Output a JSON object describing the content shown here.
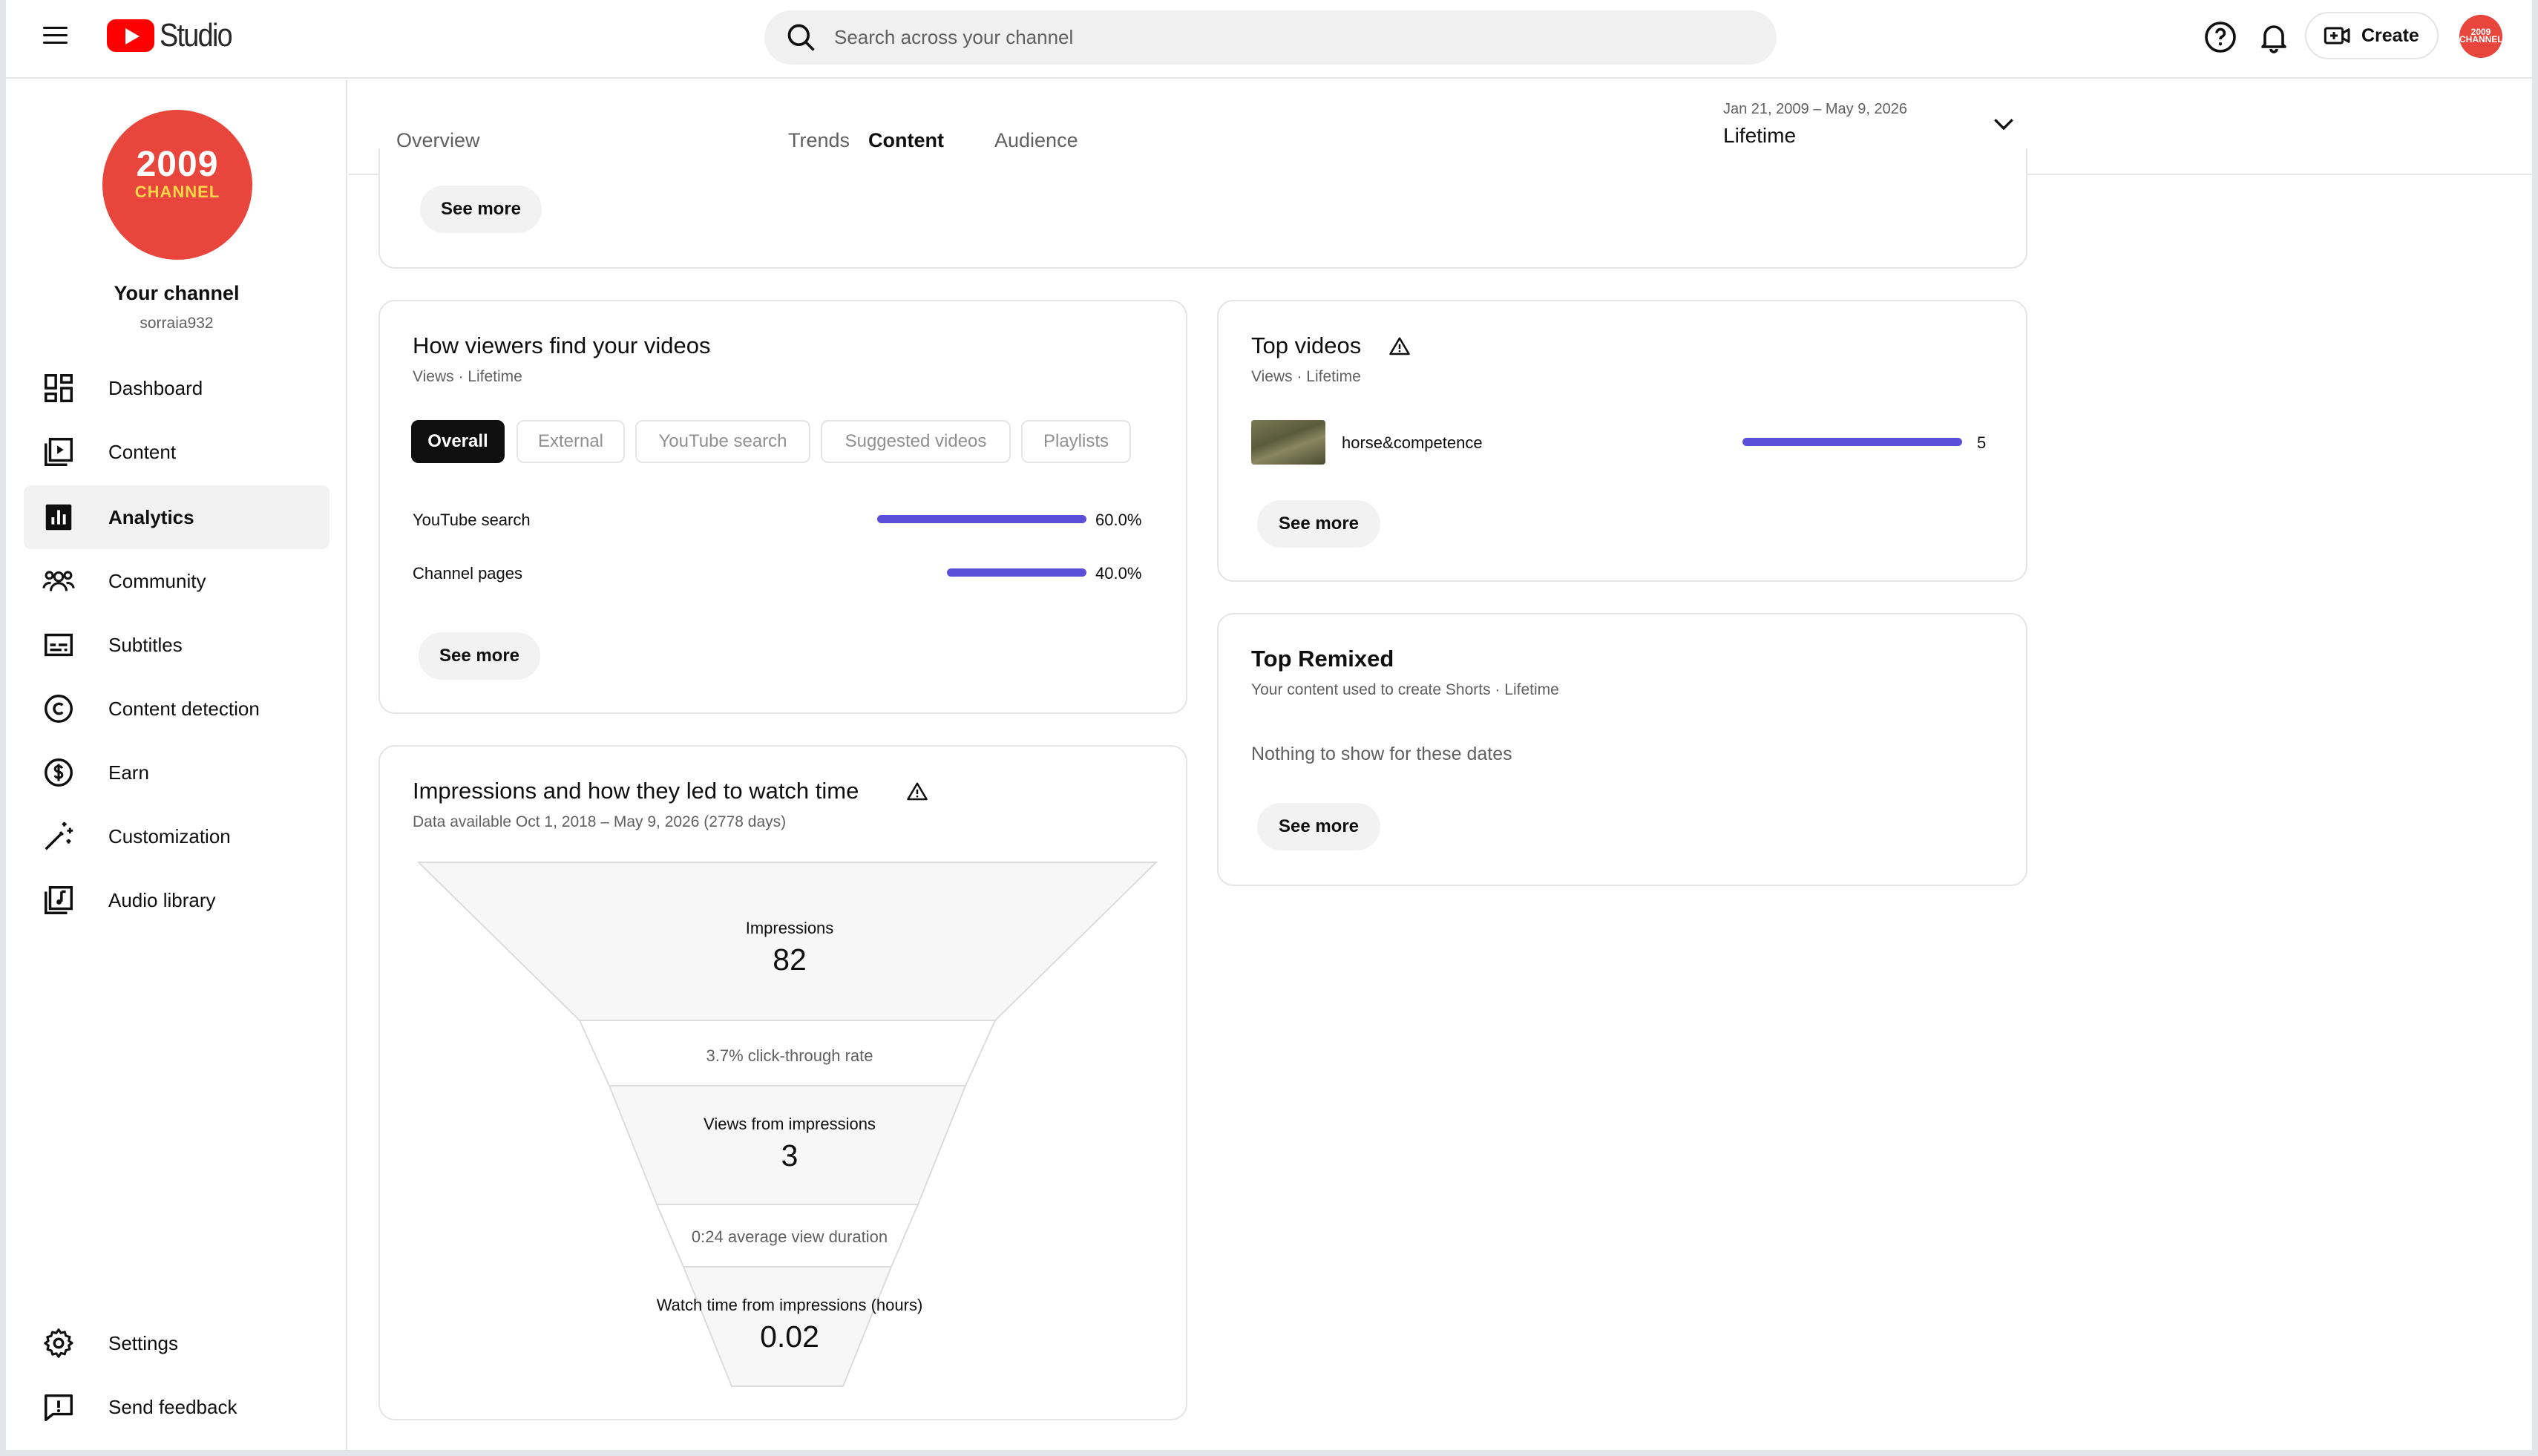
{
  "header": {
    "logo_text": "Studio",
    "search_placeholder": "Search across your channel",
    "create_label": "Create",
    "avatar_text": "2009 CHANNEL"
  },
  "sidebar": {
    "avatar_line1": "2009",
    "avatar_line2": "CHANNEL",
    "channel_name": "Your channel",
    "channel_handle": "sorraia932",
    "items": [
      {
        "label": "Dashboard",
        "icon": "dashboard-icon"
      },
      {
        "label": "Content",
        "icon": "content-icon"
      },
      {
        "label": "Analytics",
        "icon": "analytics-icon",
        "active": true
      },
      {
        "label": "Community",
        "icon": "community-icon"
      },
      {
        "label": "Subtitles",
        "icon": "subtitles-icon"
      },
      {
        "label": "Content detection",
        "icon": "copyright-icon"
      },
      {
        "label": "Earn",
        "icon": "dollar-icon"
      },
      {
        "label": "Customization",
        "icon": "magic-wand-icon"
      },
      {
        "label": "Audio library",
        "icon": "audio-library-icon"
      }
    ],
    "bottom_items": [
      {
        "label": "Settings",
        "icon": "gear-icon"
      },
      {
        "label": "Send feedback",
        "icon": "feedback-icon"
      }
    ]
  },
  "tabs": [
    {
      "label": "Overview"
    },
    {
      "label": "Content",
      "active": true
    },
    {
      "label": "Audience"
    },
    {
      "label": "Trends"
    }
  ],
  "date_range": {
    "range": "Jan 21, 2009 – May 9, 2026",
    "period": "Lifetime"
  },
  "top_card": {
    "see_more": "See more"
  },
  "how_viewers": {
    "title": "How viewers find your videos",
    "subtitle": "Views · Lifetime",
    "chips": [
      "Overall",
      "External",
      "YouTube search",
      "Suggested videos",
      "Playlists"
    ],
    "active_chip": "Overall",
    "rows": [
      {
        "label": "YouTube search",
        "value": "60.0%",
        "fraction": 0.6
      },
      {
        "label": "Channel pages",
        "value": "40.0%",
        "fraction": 0.4
      }
    ],
    "see_more": "See more"
  },
  "impressions": {
    "title": "Impressions and how they led to watch time",
    "subtitle": "Data available Oct 1, 2018 – May 9, 2026 (2778 days)",
    "impressions_label": "Impressions",
    "impressions_value": "82",
    "ctr_text": "3.7% click-through rate",
    "views_label": "Views from impressions",
    "views_value": "3",
    "avd_text": "0:24 average view duration",
    "watch_label": "Watch time from impressions (hours)",
    "watch_value": "0.02"
  },
  "top_videos": {
    "title": "Top videos",
    "subtitle": "Views · Lifetime",
    "items": [
      {
        "title": "horse&competence",
        "views": "5",
        "fraction": 1.0
      }
    ],
    "see_more": "See more"
  },
  "top_remixed": {
    "title": "Top Remixed",
    "subtitle": "Your content used to create Shorts · Lifetime",
    "empty_text": "Nothing to show for these dates",
    "see_more": "See more"
  },
  "colors": {
    "accent_bar": "#5b4fd9",
    "brand_red": "#ff0000",
    "avatar_red": "#e8453c"
  }
}
